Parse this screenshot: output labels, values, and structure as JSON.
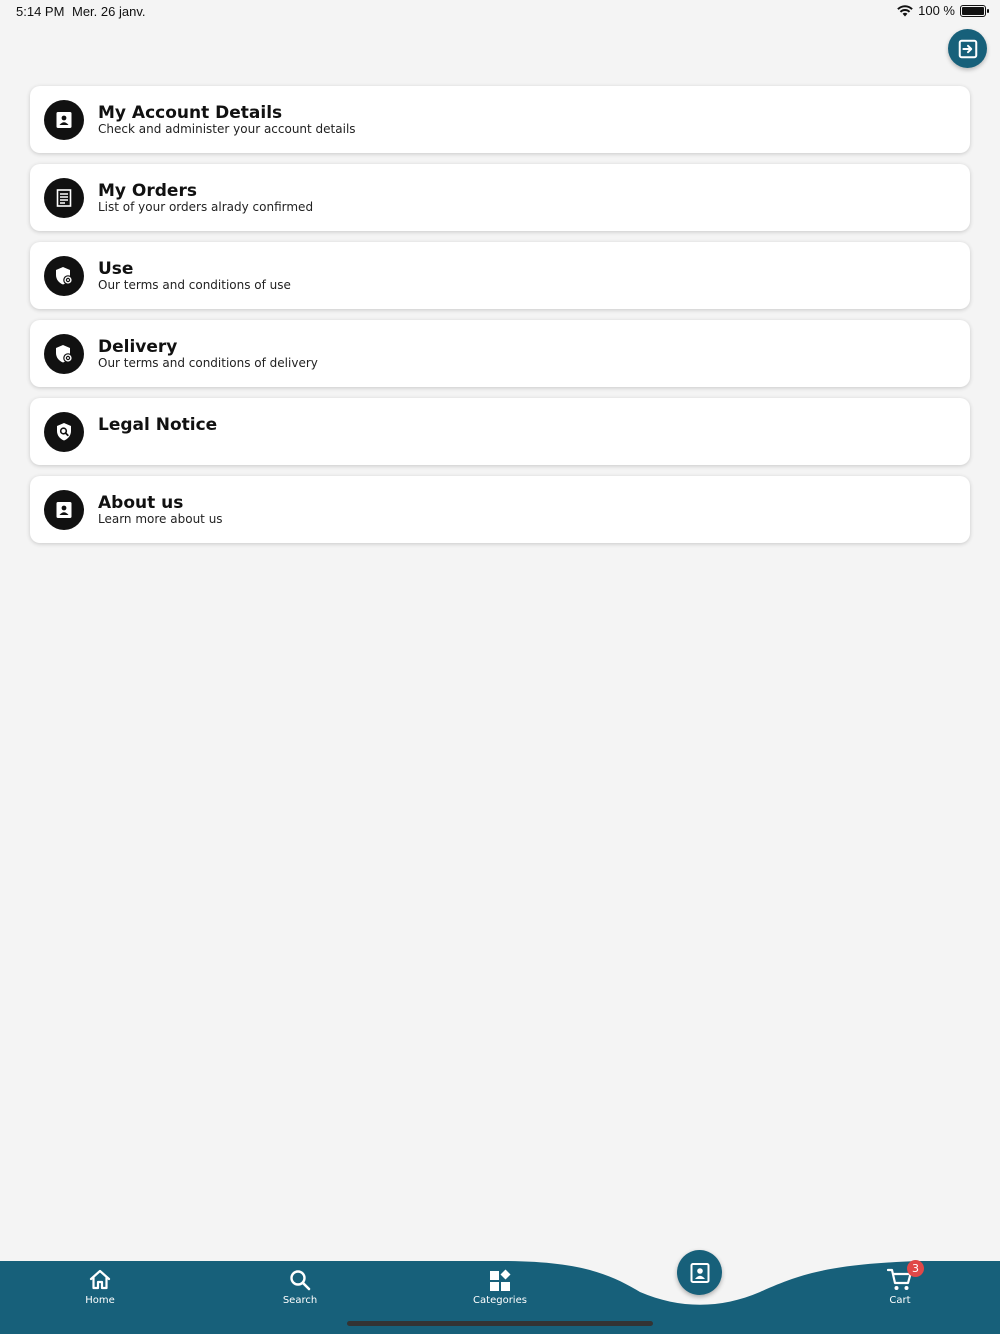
{
  "status_bar": {
    "time": "5:14 PM",
    "date": "Mer. 26 janv.",
    "battery": "100 %"
  },
  "colors": {
    "primary": "#17607a",
    "background": "#f4f4f4",
    "card": "#ffffff",
    "icon_circle": "#111111",
    "badge": "#e04848"
  },
  "menu": [
    {
      "title": "My Account Details",
      "subtitle": "Check and administer your account details",
      "icon": "account-icon"
    },
    {
      "title": "My Orders",
      "subtitle": "List of your orders alrady confirmed",
      "icon": "receipt-icon"
    },
    {
      "title": "Use",
      "subtitle": "Our terms and conditions of use",
      "icon": "shield-settings-icon"
    },
    {
      "title": "Delivery",
      "subtitle": "Our terms and conditions of delivery",
      "icon": "shield-settings-icon"
    },
    {
      "title": "Legal Notice",
      "subtitle": "",
      "icon": "shield-search-icon"
    },
    {
      "title": "About us",
      "subtitle": "Learn more about us",
      "icon": "account-icon"
    }
  ],
  "bottom_nav": {
    "home": "Home",
    "search": "Search",
    "categories": "Categories",
    "cart": "Cart",
    "cart_count": "3"
  }
}
